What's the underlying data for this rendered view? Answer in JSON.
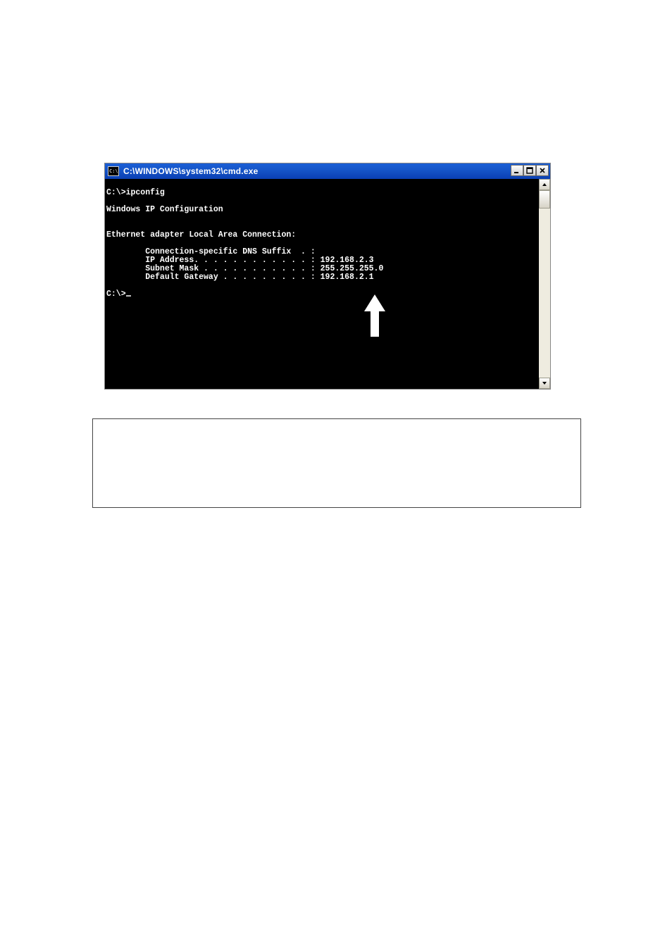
{
  "cmd_window": {
    "icon_text": "C:\\",
    "title": "C:\\WINDOWS\\system32\\cmd.exe",
    "controls": {
      "minimize_tip": "Minimize",
      "maximize_tip": "Maximize",
      "close_tip": "Close"
    },
    "lines": {
      "l1": "C:\\>ipconfig",
      "l2": "",
      "l3": "Windows IP Configuration",
      "l4": "",
      "l5": "",
      "l6": "Ethernet adapter Local Area Connection:",
      "l7": "",
      "l8": "        Connection-specific DNS Suffix  . :",
      "l9": "        IP Address. . . . . . . . . . . . : 192.168.2.3",
      "l10": "        Subnet Mask . . . . . . . . . . . : 255.255.255.0",
      "l11": "        Default Gateway . . . . . . . . . : 192.168.2.1",
      "l12": "",
      "l13_prefix": "C:\\>"
    }
  }
}
